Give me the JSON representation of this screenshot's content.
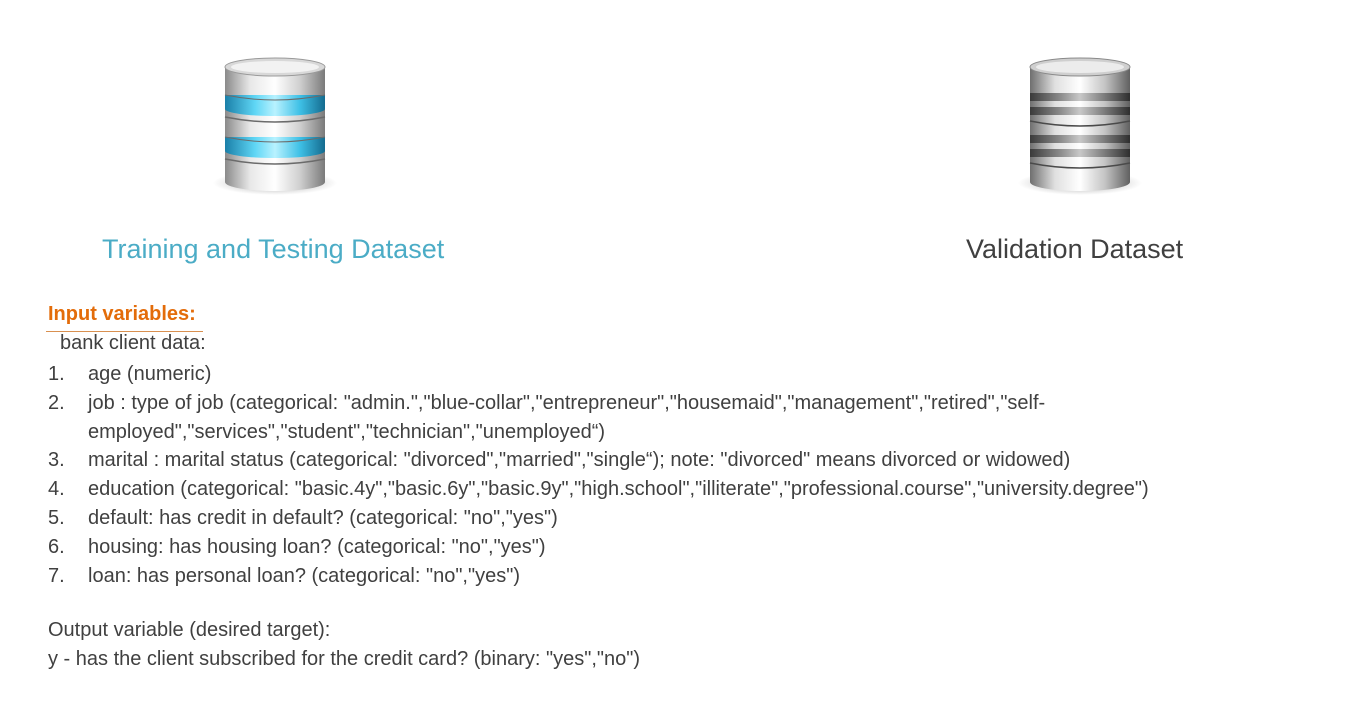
{
  "datasets": [
    {
      "caption": "Training and Testing Dataset",
      "icon": "database-icon",
      "accent": "#4bacc6"
    },
    {
      "caption": "Validation Dataset",
      "icon": "database-icon",
      "accent": "#404040"
    }
  ],
  "input": {
    "heading": "Input variables:",
    "subheading": "bank client data:",
    "items": [
      {
        "num": "1.",
        "lines": [
          "age (numeric)"
        ]
      },
      {
        "num": "2.",
        "lines": [
          "job : type of job (categorical: \"admin.\",\"blue-collar\",\"entrepreneur\",\"housemaid\",\"management\",\"retired\",\"self-",
          "employed\",\"services\",\"student\",\"technician\",\"unemployed“)"
        ]
      },
      {
        "num": "3.",
        "lines": [
          "marital : marital status (categorical: \"divorced\",\"married\",\"single“); note: \"divorced\" means divorced or widowed)"
        ]
      },
      {
        "num": "4.",
        "lines": [
          "education (categorical: \"basic.4y\",\"basic.6y\",\"basic.9y\",\"high.school\",\"illiterate\",\"professional.course\",\"university.degree\")"
        ]
      },
      {
        "num": "5.",
        "lines": [
          "default: has credit in default? (categorical: \"no\",\"yes\")"
        ]
      },
      {
        "num": "6.",
        "lines": [
          "housing: has housing loan? (categorical: \"no\",\"yes\")"
        ]
      },
      {
        "num": "7.",
        "lines": [
          "loan: has personal loan? (categorical: \"no\",\"yes\")"
        ]
      }
    ]
  },
  "output": {
    "label": "Output variable (desired target):",
    "description": "y - has the client subscribed for the credit card? (binary: \"yes\",\"no\")"
  },
  "colors": {
    "heading": "#e36c0a",
    "text": "#404040"
  }
}
